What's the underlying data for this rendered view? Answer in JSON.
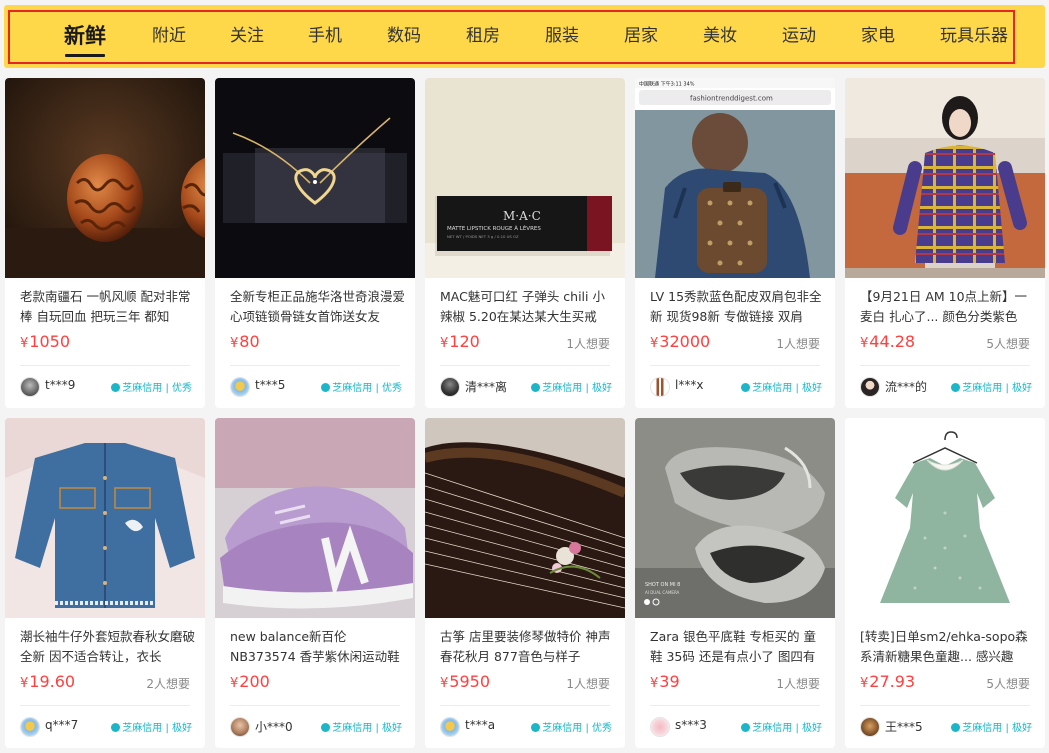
{
  "nav": {
    "tabs": [
      {
        "label": "新鲜",
        "active": true
      },
      {
        "label": "附近"
      },
      {
        "label": "关注"
      },
      {
        "label": "手机"
      },
      {
        "label": "数码"
      },
      {
        "label": "租房"
      },
      {
        "label": "服装"
      },
      {
        "label": "居家"
      },
      {
        "label": "美妆"
      },
      {
        "label": "运动"
      },
      {
        "label": "家电"
      },
      {
        "label": "玩具乐器"
      }
    ]
  },
  "currency_symbol": "¥",
  "products": [
    {
      "title": "老款南疆石 一帆风顺 配对非常棒 自玩回血 把玩三年 都知",
      "price": "1050",
      "wants": "",
      "seller": "t***9",
      "credit": "芝麻信用 | 优秀",
      "image": "walnuts-photo"
    },
    {
      "title": "全新专柜正品施华洛世奇浪漫爱心项链锁骨链女首饰送女友",
      "price": "80",
      "wants": "",
      "seller": "t***5",
      "credit": "芝麻信用 | 优秀",
      "image": "heart-necklace-photo"
    },
    {
      "title": "MAC魅可口红 子弹头 chili 小辣椒 5.20在某达某大生买戒",
      "price": "120",
      "wants": "1人想要",
      "seller": "清***离",
      "credit": "芝麻信用 | 极好",
      "image": "lipstick-box-photo"
    },
    {
      "title": "LV 15秀款蓝色配皮双肩包非全新 现货98新 专做链接 双肩",
      "price": "32000",
      "wants": "1人想要",
      "seller": "l***x",
      "credit": "芝麻信用 | 极好",
      "image": "backpack-screenshot-photo"
    },
    {
      "title": "【9月21日 AM 10点上新】一麦白 扎心了... 颜色分类紫色",
      "price": "44.28",
      "wants": "5人想要",
      "seller": "流***的",
      "credit": "芝麻信用 | 极好",
      "image": "plaid-dress-model-photo"
    },
    {
      "title": "潮长袖牛仔外套短款春秋女磨破 全新 因不适合转让，衣长",
      "price": "19.60",
      "wants": "2人想要",
      "seller": "q***7",
      "credit": "芝麻信用 | 极好",
      "image": "denim-jacket-photo"
    },
    {
      "title": "new balance新百伦NB373574 香芋紫休闲运动鞋 这双鞋真",
      "price": "200",
      "wants": "",
      "seller": "小***0",
      "credit": "芝麻信用 | 极好",
      "image": "purple-sneakers-photo"
    },
    {
      "title": "古筝 店里要装修琴做特价 神声 春花秋月 877音色与样子",
      "price": "5950",
      "wants": "1人想要",
      "seller": "t***a",
      "credit": "芝麻信用 | 优秀",
      "image": "guzheng-photo"
    },
    {
      "title": "Zara 银色平底鞋 专柜买的 童鞋 35码 还是有点小了 图四有",
      "price": "39",
      "wants": "1人想要",
      "seller": "s***3",
      "credit": "芝麻信用 | 极好",
      "image": "silver-flats-photo"
    },
    {
      "title": "[转卖]日单sm2/ehka-sopo森系清新糖果色童趣... 感兴趣",
      "price": "27.93",
      "wants": "5人想要",
      "seller": "王***5",
      "credit": "芝麻信用 | 极好",
      "image": "green-dress-photo"
    }
  ],
  "thumb_texts": {
    "lipstick": [
      "MATTE LIPSTICK  ROUGE À LÈVRES",
      "NET WT / POIDS NET 3 g / 0.10 US OZ"
    ],
    "lipstick_brand": "M·A·C",
    "browser_url": "fashiontrenddigest.com",
    "status_bar": "中国联通  下午3:11  34%",
    "camera_stamp": "SHOT ON MI 8",
    "camera_stamp_2": "AI DUAL CAMERA"
  },
  "colors": {
    "nav_bg": "#ffd84a",
    "nav_frame": "#e4262a",
    "price": "#ff4040",
    "credit": "#1bb6c7"
  }
}
